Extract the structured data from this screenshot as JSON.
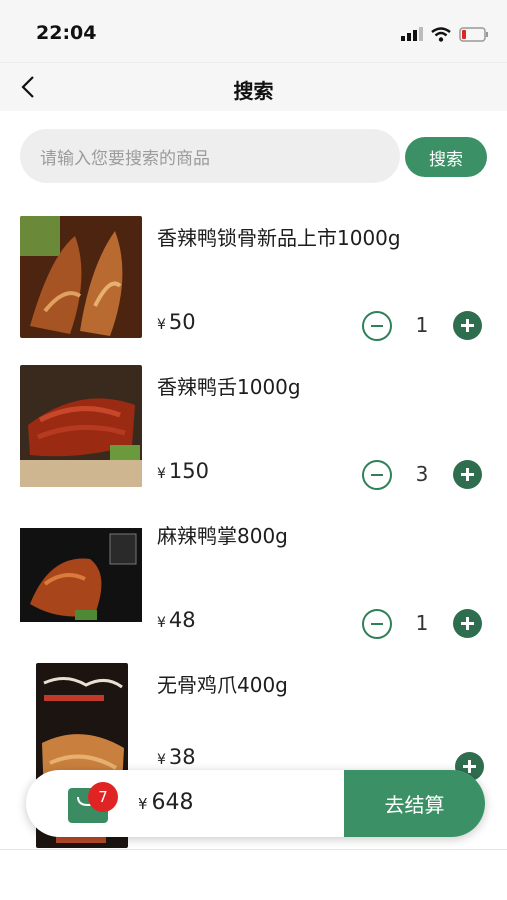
{
  "status_bar": {
    "time": "22:04"
  },
  "header": {
    "title": "搜索"
  },
  "search": {
    "placeholder": "请输入您要搜索的商品",
    "button_label": "搜索"
  },
  "currency_symbol": "¥",
  "items": [
    {
      "name": "香辣鸭锁骨新品上市1000g",
      "price": "50",
      "quantity": "1"
    },
    {
      "name": "香辣鸭舌1000g",
      "price": "150",
      "quantity": "3"
    },
    {
      "name": "麻辣鸭掌800g",
      "price": "48",
      "quantity": "1"
    },
    {
      "name": "无骨鸡爪400g",
      "price": "38",
      "quantity": ""
    }
  ],
  "cart": {
    "badge_count": "7",
    "total": "648",
    "checkout_label": "去结算"
  },
  "colors": {
    "primary": "#3b9165",
    "badge": "#e02424"
  }
}
